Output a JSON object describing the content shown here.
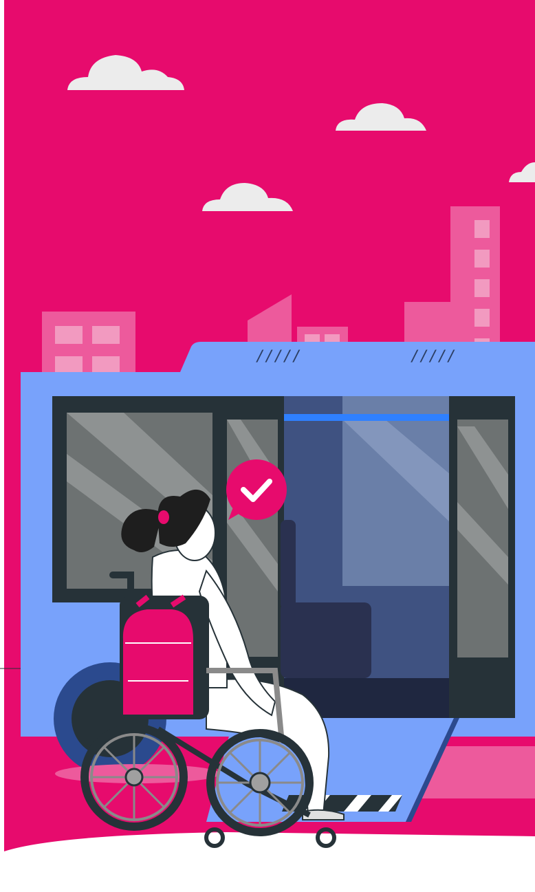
{
  "scene": {
    "description_label": "",
    "colors": {
      "sky": "#e70b6d",
      "cloud": "#ececec",
      "building": "#ed5a9c",
      "building_window": "#f29ac0",
      "bus_body": "#78a2fb",
      "bus_roof": "#6a90ea",
      "bus_frame": "#263238",
      "window_glass": "#6d7272",
      "interior": "#3f5281",
      "seat": "#2a3150",
      "check_bubble": "#e70b6d",
      "backpack": "#e70b6d",
      "hair": "#1e1e1e",
      "wheel": "#8a8a8a",
      "ground": "#ffffff"
    },
    "roof_markings": [
      "/////",
      "/////"
    ],
    "icons": [
      "checkmark-bubble-icon",
      "wheelchair-icon",
      "backpack-icon"
    ]
  }
}
